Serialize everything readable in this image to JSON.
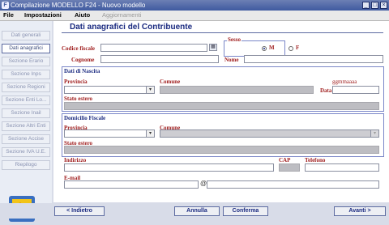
{
  "window": {
    "title": "Compilazione MODELLO F24 - Nuovo modello",
    "app_icon": "f24-app-icon",
    "controls": [
      "minimize-icon",
      "maximize-icon",
      "close-icon"
    ]
  },
  "menu": {
    "items": [
      "File",
      "Impostazioni",
      "Aiuto"
    ],
    "disabled_item": "Aggiornamenti"
  },
  "sidebar": {
    "items": [
      {
        "label": "Dati generali",
        "active": false
      },
      {
        "label": "Dati anagrafici",
        "active": true
      },
      {
        "label": "Sezione Erario",
        "active": false
      },
      {
        "label": "Sezione Inps",
        "active": false
      },
      {
        "label": "Sezione Regioni",
        "active": false
      },
      {
        "label": "Sezione Enti Lo...",
        "active": false
      },
      {
        "label": "Sezione Inail",
        "active": false
      },
      {
        "label": "Sezione Altri Enti",
        "active": false
      },
      {
        "label": "Sezione Accise",
        "active": false
      },
      {
        "label": "Sezione IVA U.E.",
        "active": false
      },
      {
        "label": "Riepilogo",
        "active": false
      }
    ],
    "logo": "f24-logo"
  },
  "form": {
    "title": "Dati anagrafici del Contribuente",
    "codice_fiscale_label": "Codice fiscale",
    "codice_fiscale_value": "",
    "cognome_label": "Cognome",
    "cognome_value": "",
    "nome_label": "Nome",
    "nome_value": "",
    "sesso_label": "Sesso",
    "sesso_options": [
      "M",
      "F"
    ],
    "sesso_selected": "M",
    "nascita": {
      "section": "Dati di Nascita",
      "provincia_label": "Provincia",
      "comune_label": "Comune",
      "data_format": "ggmmaaaa",
      "data_label": "Data",
      "stato_estero_label": "Stato estero"
    },
    "domicilio": {
      "section": "Domicilio Fiscale",
      "provincia_label": "Provincia",
      "comune_label": "Comune",
      "stato_estero_label": "Stato estero",
      "indirizzo_label": "Indirizzo",
      "cap_label": "CAP",
      "telefono_label": "Telefono",
      "email_label": "E-mail",
      "email_at": "@"
    }
  },
  "buttons": {
    "indietro": "< Indietro",
    "annulla": "Annulla",
    "conferma": "Conferma",
    "avanti": "Avanti >"
  }
}
